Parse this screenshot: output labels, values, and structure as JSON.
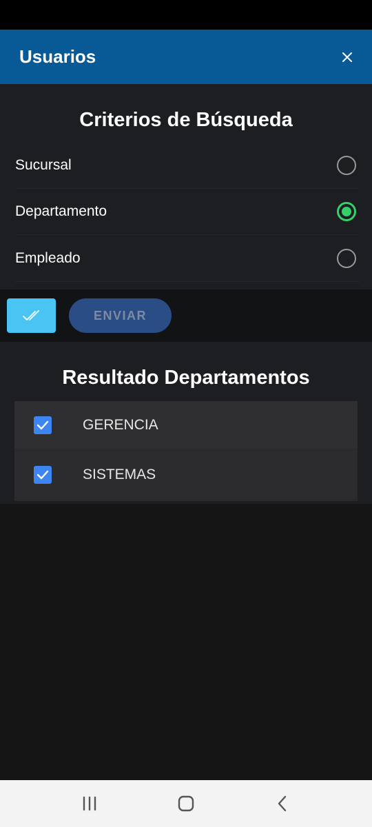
{
  "header": {
    "title": "Usuarios",
    "close_icon": "close-icon"
  },
  "criteria": {
    "title": "Criterios de Búsqueda",
    "options": [
      {
        "label": "Sucursal",
        "selected": false
      },
      {
        "label": "Departamento",
        "selected": true
      },
      {
        "label": "Empleado",
        "selected": false
      }
    ]
  },
  "toolbar": {
    "select_all_icon": "double-check-icon",
    "send_label": "ENVIAR"
  },
  "results": {
    "title": "Resultado Departamentos",
    "items": [
      {
        "label": "GERENCIA",
        "checked": true
      },
      {
        "label": "SISTEMAS",
        "checked": true
      }
    ]
  },
  "colors": {
    "header": "#075a96",
    "radio_selected": "#35d06a",
    "checkbox": "#3d86f2",
    "select_all_button": "#4ac4f3",
    "send_button": "#2b4d86"
  },
  "nav": {
    "recent_icon": "recent-apps-icon",
    "home_icon": "home-icon",
    "back_icon": "back-icon"
  }
}
